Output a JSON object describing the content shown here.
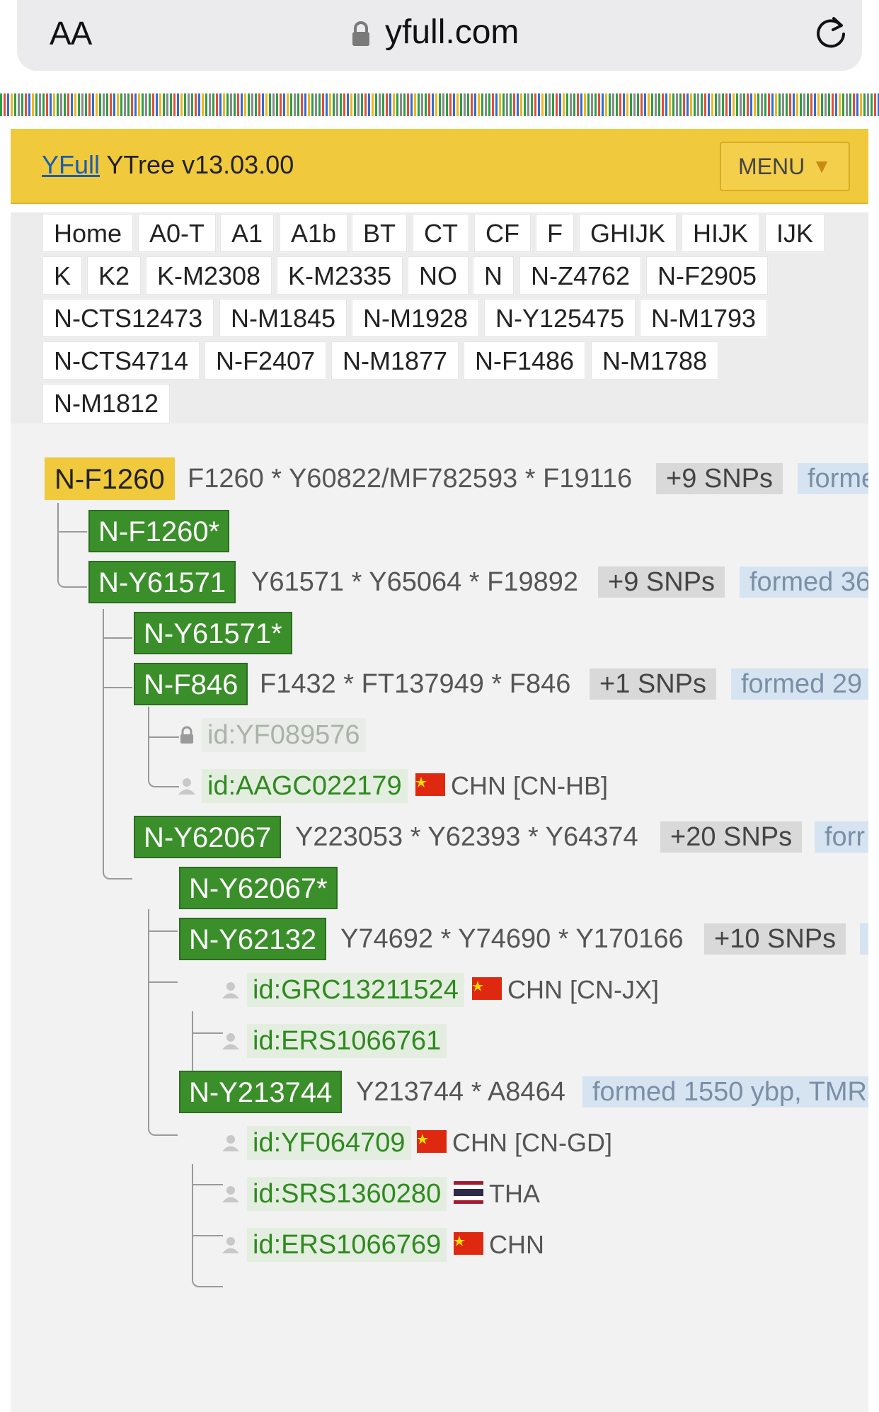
{
  "browser": {
    "text_size_label": "AA",
    "domain": "yfull.com"
  },
  "header": {
    "brand_link": "YFull",
    "brand_rest": " YTree v13.03.00",
    "menu_label": "MENU",
    "menu_caret": "▼"
  },
  "breadcrumbs": [
    "Home",
    "A0-T",
    "A1",
    "A1b",
    "BT",
    "CT",
    "CF",
    "F",
    "GHIJK",
    "HIJK",
    "IJK",
    "K",
    "K2",
    "K-M2308",
    "K-M2335",
    "NO",
    "N",
    "N-Z4762",
    "N-F2905",
    "N-CTS12473",
    "N-M1845",
    "N-M1928",
    "N-Y125475",
    "N-M1793",
    "N-CTS4714",
    "N-F2407",
    "N-M1877",
    "N-F1486",
    "N-M1788",
    "N-M1812"
  ],
  "tree": {
    "root": {
      "label": "N-F1260",
      "snps": "F1260 * Y60822/MF782593 * F19116",
      "snp_badge": "+9 SNPs",
      "formed": "forme"
    },
    "n_f1260_star": {
      "label": "N-F1260*"
    },
    "n_y61571": {
      "label": "N-Y61571",
      "snps": "Y61571 * Y65064 * F19892",
      "snp_badge": "+9 SNPs",
      "formed": "formed 36"
    },
    "n_y61571_star": {
      "label": "N-Y61571*"
    },
    "n_f846": {
      "label": "N-F846",
      "snps": "F1432 * FT137949 * F846",
      "snp_badge": "+1 SNPs",
      "formed": "formed 29"
    },
    "s_yf089576": {
      "label": "id:YF089576"
    },
    "s_aagc022179": {
      "label": "id:AAGC022179",
      "country": "CHN [CN-HB]"
    },
    "n_y62067": {
      "label": "N-Y62067",
      "snps": "Y223053 * Y62393 * Y64374",
      "snp_badge": "+20 SNPs",
      "formed": "forr"
    },
    "n_y62067_star": {
      "label": "N-Y62067*"
    },
    "n_y62132": {
      "label": "N-Y62132",
      "snps": "Y74692 * Y74690 * Y170166",
      "snp_badge": "+10 SNPs"
    },
    "s_grc13211524": {
      "label": "id:GRC13211524",
      "country": "CHN [CN-JX]"
    },
    "s_ers1066761": {
      "label": "id:ERS1066761"
    },
    "n_y213744": {
      "label": "N-Y213744",
      "snps": "Y213744 * A8464",
      "formed": "formed 1550 ybp, TMR"
    },
    "s_yf064709": {
      "label": "id:YF064709",
      "country": "CHN [CN-GD]"
    },
    "s_srs1360280": {
      "label": "id:SRS1360280",
      "country": "THA"
    },
    "s_ers1066769": {
      "label": "id:ERS1066769",
      "country": "CHN"
    }
  }
}
